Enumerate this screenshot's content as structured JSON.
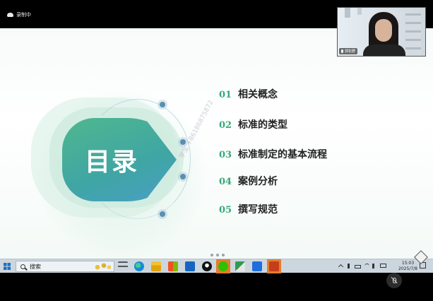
{
  "recording": {
    "label": "录制中"
  },
  "webcam": {
    "name": "郭松野"
  },
  "slide": {
    "title": "目录",
    "watermark": "学宝 +86186875872",
    "items": [
      {
        "num": "01",
        "label": "相关概念"
      },
      {
        "num": "02",
        "label": "标准的类型"
      },
      {
        "num": "03",
        "label": "标准制定的基本流程"
      },
      {
        "num": "04",
        "label": "案例分析"
      },
      {
        "num": "05",
        "label": "撰写规范"
      }
    ]
  },
  "taskbar": {
    "search_label": "搜索",
    "apps": [
      "start-icon",
      "task-view-icon",
      "edge-icon",
      "file-explorer-icon",
      "store-icon",
      "mail-icon",
      "qq-icon",
      "wechat-icon",
      "photos-icon",
      "meeting-icon",
      "powerpoint-icon"
    ],
    "active_app": "powerpoint-icon",
    "time": "15:03",
    "date": "2025/7/8"
  },
  "colors": {
    "accent_green": "#34a877",
    "shield_start": "#4fb78e",
    "shield_end": "#4aa0c4",
    "taskbar": "#ccd6df",
    "active_app": "#e57d2d"
  }
}
